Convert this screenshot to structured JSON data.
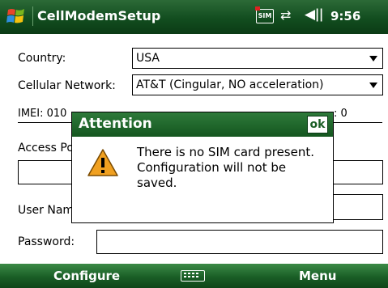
{
  "titlebar": {
    "app_title": "CellModemSetup",
    "sim_label": "SIM",
    "clock": "9:56",
    "icons": [
      "windows-start-icon",
      "sim-card-icon",
      "connectivity-icon",
      "volume-icon"
    ]
  },
  "form": {
    "country_label": "Country:",
    "country_value": "USA",
    "network_label": "Cellular Network:",
    "network_value": "AT&T (Cingular, NO acceleration)",
    "imei_label": "IMEI: 010",
    "imei_tail": ": 0",
    "access_point_label": "Access Po",
    "access_point_value": "",
    "user_name_label": "User Nam",
    "user_name_value": "",
    "password_label": "Password:",
    "password_value": ""
  },
  "dialog": {
    "title": "Attention",
    "ok_label": "ok",
    "message": "There is no SIM card present.  Configuration will not be saved.",
    "icon": "warning-icon"
  },
  "softkeys": {
    "left": "Configure",
    "right": "Menu",
    "center_icon": "keyboard-icon"
  },
  "colors": {
    "bar_green": "#14561f",
    "warning_orange": "#f0a020"
  }
}
